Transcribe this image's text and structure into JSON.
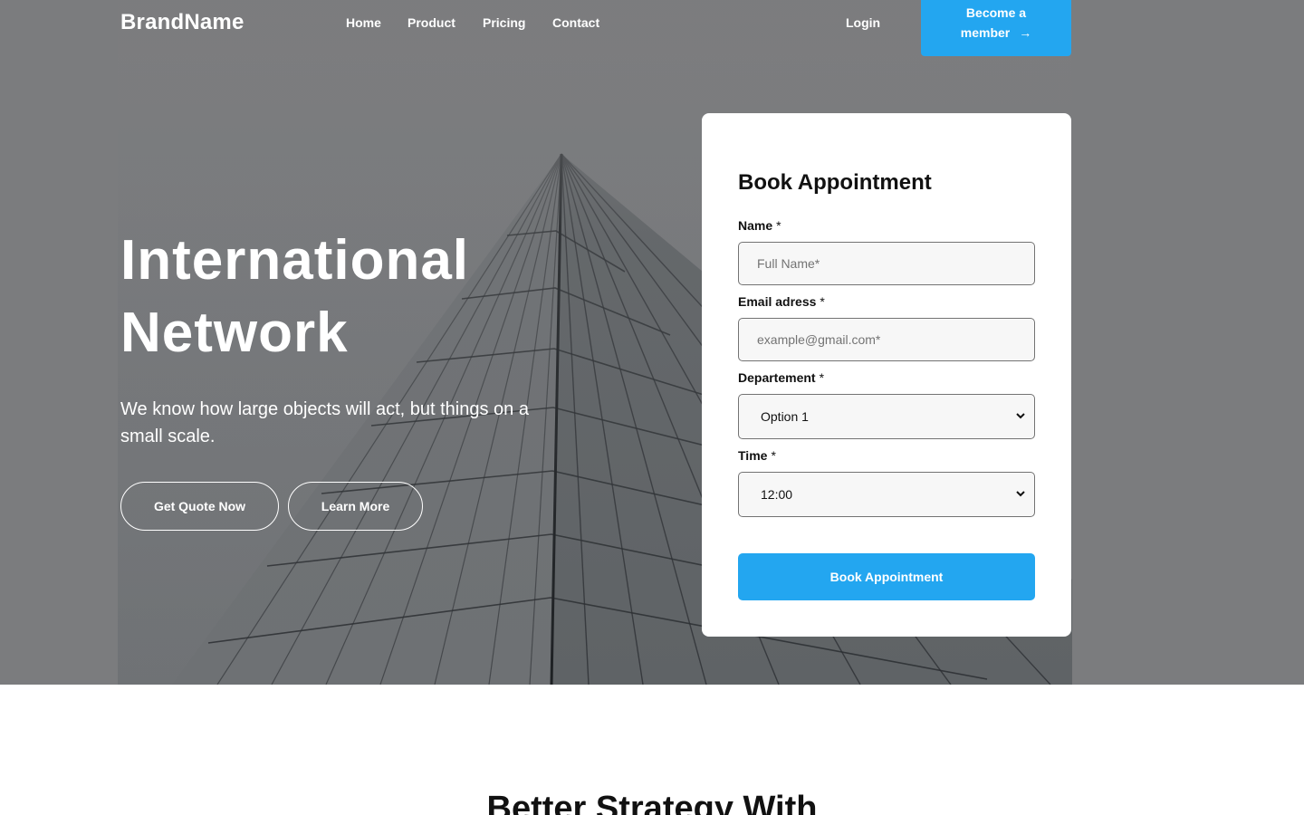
{
  "brand": "BrandName",
  "nav": {
    "home": "Home",
    "product": "Product",
    "pricing": "Pricing",
    "contact": "Contact",
    "login": "Login",
    "member_line1": "Become a",
    "member_line2": "member",
    "member_arrow": "→"
  },
  "hero": {
    "title_line1": "International",
    "title_line2": "Network",
    "subtitle": "We know how large objects will act, but things on a small scale.",
    "quote_button": "Get Quote Now",
    "learn_button": "Learn More"
  },
  "form": {
    "title": "Book Appointment",
    "required_mark": "*",
    "name_label": "Name",
    "name_placeholder": "Full Name*",
    "email_label": "Email adress",
    "email_placeholder": "example@gmail.com*",
    "department_label": "Departement",
    "department_value": "Option 1",
    "time_label": "Time",
    "time_value": "12:00",
    "submit_label": "Book Appointment"
  },
  "section": {
    "heading": "Better Strategy With"
  },
  "colors": {
    "accent": "#23a6f0",
    "hero_overlay": "#7b7c7e",
    "text_dark": "#111111"
  },
  "icons": {
    "member_arrow": "arrow-right-icon",
    "select_chevron": "chevron-down-icon"
  }
}
